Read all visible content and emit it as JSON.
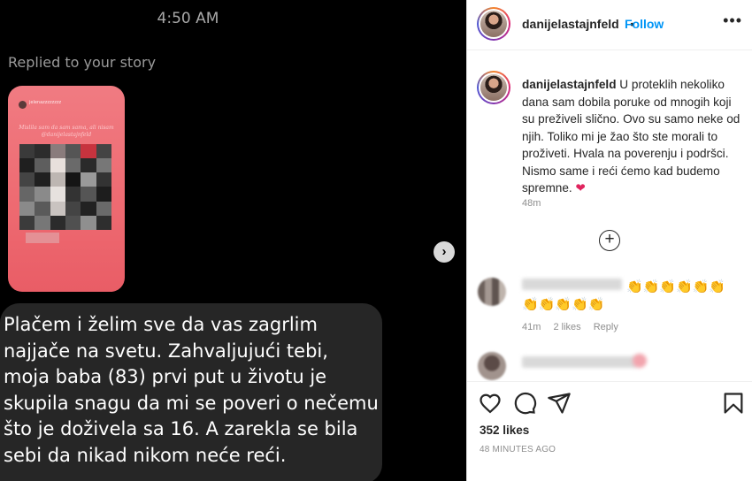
{
  "dm": {
    "time": "4:50 AM",
    "replied_label": "Replied to your story",
    "story_user": "jelenazzzzzzzz",
    "story_caption": "Mislila sam da sam sama, ali nisam @danijelastajnfeld",
    "message": "Plačem i želim sve da vas zagrlim najjače na svetu. Zahvaljujući tebi, moja baba (83) prvi put u životu je skupila snagu da mi se poveri o nečemu što je doživela sa 16. A zarekla se bila sebi da nikad nikom neće reći."
  },
  "post": {
    "username": "danijelastajnfeld",
    "dot": "•",
    "follow_label": "Follow",
    "more_icon": "•••",
    "caption_user": "danijelastajnfeld",
    "caption_text": "U proteklih nekoliko dana sam dobila poruke od mnogih koji su preživeli slično. Ovo su samo neke od njih. Toliko mi je žao što ste morali to proživeti. Hvala na poverenju i podršci. Nismo same i reći ćemo kad budemo spremne.",
    "caption_heart": "❤",
    "caption_time": "48m",
    "load_more_icon": "+",
    "comment1_emojis": "👏👏👏👏👏👏 👏👏👏👏👏",
    "comment1_time": "41m",
    "comment1_likes": "2 likes",
    "comment1_reply": "Reply",
    "likes": "352 likes",
    "posted_ago": "48 MINUTES AGO"
  },
  "icons": [
    "heart-icon",
    "comment-icon",
    "share-icon",
    "bookmark-icon",
    "chevron-right-icon"
  ],
  "colors": {
    "follow": "#0095f6",
    "story": "#ee6b72",
    "bubble": "#262626"
  }
}
